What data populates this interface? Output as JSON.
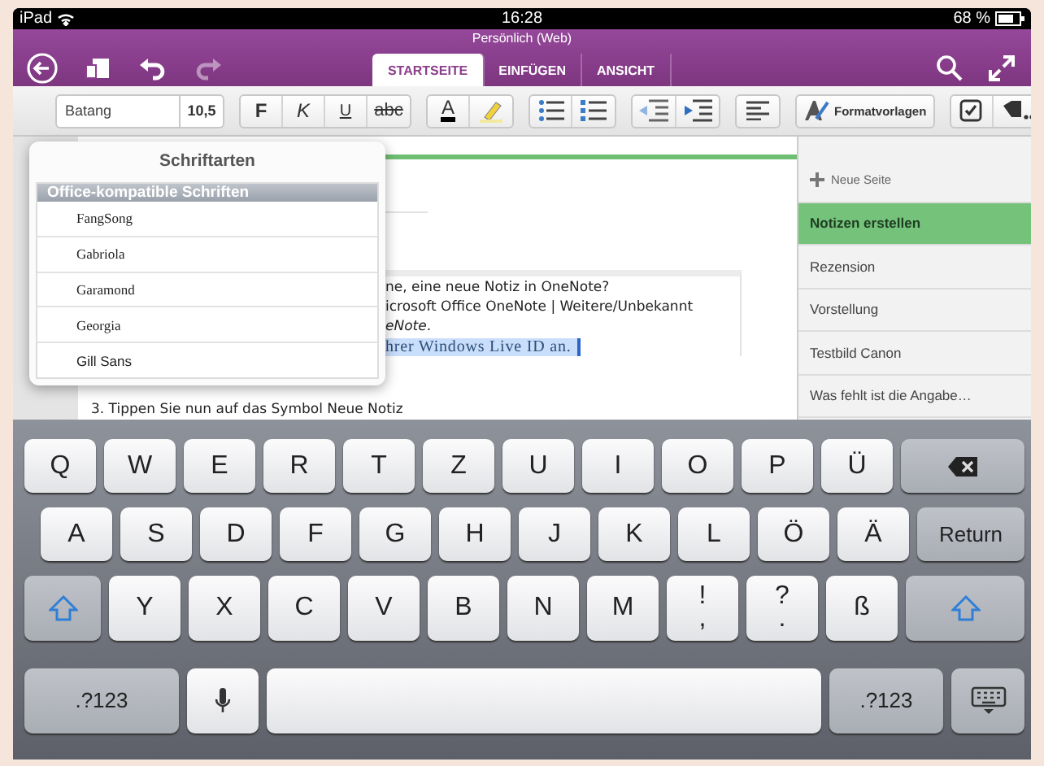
{
  "status_bar": {
    "device": "iPad",
    "time": "16:28",
    "battery": "68 %"
  },
  "header": {
    "title": "Persönlich (Web)",
    "buttons": [
      {
        "kind": "back",
        "disabled": false
      },
      {
        "kind": "copy",
        "disabled": false
      },
      {
        "kind": "undo",
        "disabled": false
      },
      {
        "kind": "redo",
        "disabled": true
      }
    ],
    "tabs": [
      {
        "label": "STARTSEITE",
        "selected": true
      },
      {
        "label": "EINFÜGEN",
        "selected": false
      },
      {
        "label": "ANSICHT",
        "selected": false
      }
    ],
    "actions": [
      {
        "kind": "search"
      },
      {
        "kind": "expand"
      }
    ]
  },
  "toolbar": {
    "font": "Batang",
    "size": "10,5",
    "groups": [
      [
        {
          "kind": "bold",
          "label": "F"
        },
        {
          "kind": "italic",
          "label": "K"
        },
        {
          "kind": "underline",
          "label": "U"
        },
        {
          "kind": "strike",
          "label": "abc"
        }
      ],
      [
        {
          "kind": "font-color",
          "label": "A"
        },
        {
          "kind": "highlight"
        }
      ],
      [
        {
          "kind": "bullets"
        },
        {
          "kind": "numbering"
        }
      ],
      [
        {
          "kind": "outdent"
        },
        {
          "kind": "indent"
        }
      ],
      [
        {
          "kind": "align"
        }
      ],
      [
        {
          "kind": "styles",
          "label": "Formatvorlagen"
        }
      ],
      [
        {
          "kind": "checkbox"
        },
        {
          "kind": "tag"
        }
      ]
    ]
  },
  "font_popup": {
    "title": "Schriftarten",
    "section": "Office-kompatible Schriften",
    "fonts": [
      "FangSong",
      "Gabriola",
      "Garamond",
      "Georgia",
      "Gill Sans"
    ]
  },
  "note": {
    "lines": [
      {
        "text": "ne, eine neue Notiz in OneNote?",
        "selected": false
      },
      {
        "text": "icrosoft Office OneNote | Weitere/Unbekannt",
        "selected": false
      },
      {
        "text": "*eNote*.",
        "selected": false
      },
      {
        "text": "hrer Windows Live ID an.",
        "selected": true
      }
    ],
    "step": "3. Tippen Sie nun auf das Symbol Neue Notiz"
  },
  "pages": {
    "new_label": "Neue Seite",
    "items": [
      {
        "title": "Notizen erstellen",
        "selected": true
      },
      {
        "title": "Rezension",
        "selected": false
      },
      {
        "title": "Vorstellung",
        "selected": false
      },
      {
        "title": "Testbild Canon",
        "selected": false
      },
      {
        "title": "Was fehlt ist die Angabe…",
        "selected": false
      }
    ]
  },
  "keyboard": {
    "rows": [
      [
        {
          "kind": "letter",
          "label": "Q"
        },
        {
          "kind": "letter",
          "label": "W"
        },
        {
          "kind": "letter",
          "label": "E"
        },
        {
          "kind": "letter",
          "label": "R"
        },
        {
          "kind": "letter",
          "label": "T"
        },
        {
          "kind": "letter",
          "label": "Z"
        },
        {
          "kind": "letter",
          "label": "U"
        },
        {
          "kind": "letter",
          "label": "I"
        },
        {
          "kind": "letter",
          "label": "O"
        },
        {
          "kind": "letter",
          "label": "P"
        },
        {
          "kind": "letter",
          "label": "Ü"
        },
        {
          "kind": "backspace"
        }
      ],
      [
        {
          "kind": "letter",
          "label": "A"
        },
        {
          "kind": "letter",
          "label": "S"
        },
        {
          "kind": "letter",
          "label": "D"
        },
        {
          "kind": "letter",
          "label": "F"
        },
        {
          "kind": "letter",
          "label": "G"
        },
        {
          "kind": "letter",
          "label": "H"
        },
        {
          "kind": "letter",
          "label": "J"
        },
        {
          "kind": "letter",
          "label": "K"
        },
        {
          "kind": "letter",
          "label": "L"
        },
        {
          "kind": "letter",
          "label": "Ö"
        },
        {
          "kind": "letter",
          "label": "Ä"
        },
        {
          "kind": "return",
          "label": "Return"
        }
      ],
      [
        {
          "kind": "shift"
        },
        {
          "kind": "letter",
          "label": "Y"
        },
        {
          "kind": "letter",
          "label": "X"
        },
        {
          "kind": "letter",
          "label": "C"
        },
        {
          "kind": "letter",
          "label": "V"
        },
        {
          "kind": "letter",
          "label": "B"
        },
        {
          "kind": "letter",
          "label": "N"
        },
        {
          "kind": "letter",
          "label": "M"
        },
        {
          "kind": "dual",
          "label": "!",
          "sub": ","
        },
        {
          "kind": "dual",
          "label": "?",
          "sub": "."
        },
        {
          "kind": "letter",
          "label": "ß"
        },
        {
          "kind": "shift"
        }
      ],
      [
        {
          "kind": "numbers",
          "label": ".?123"
        },
        {
          "kind": "mic"
        },
        {
          "kind": "space"
        },
        {
          "kind": "numbers",
          "label": ".?123"
        },
        {
          "kind": "hide"
        }
      ]
    ]
  }
}
